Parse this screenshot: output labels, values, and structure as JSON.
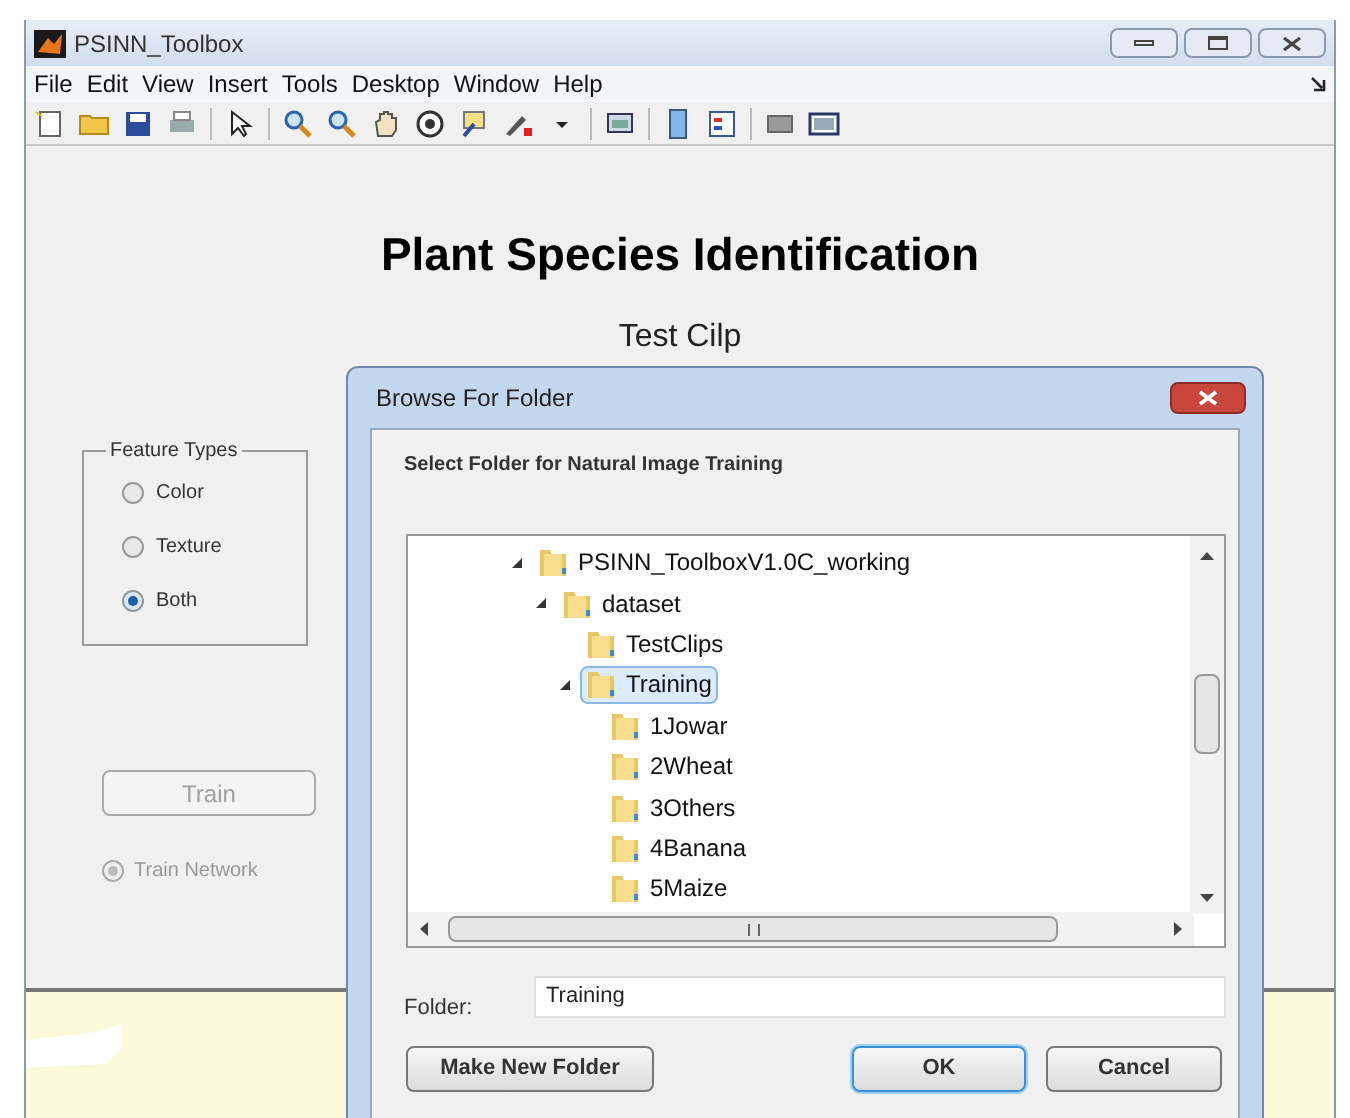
{
  "window": {
    "title": "PSINN_Toolbox"
  },
  "menu": [
    "File",
    "Edit",
    "View",
    "Insert",
    "Tools",
    "Desktop",
    "Window",
    "Help"
  ],
  "heading": "Plant Species Identification",
  "subtitle": "Test Cilp",
  "feature_types": {
    "title": "Feature Types",
    "options": [
      {
        "label": "Color",
        "selected": false
      },
      {
        "label": "Texture",
        "selected": false
      },
      {
        "label": "Both",
        "selected": true
      }
    ]
  },
  "train_button": {
    "label": "Train",
    "disabled": true
  },
  "train_network": {
    "label": "Train Network",
    "disabled": true
  },
  "dialog": {
    "title": "Browse For Folder",
    "instruction": "Select Folder for Natural Image Training",
    "tree": [
      {
        "label": "PSINN_ToolboxV1.0C_working",
        "expanded": true,
        "selected": false,
        "children": [
          {
            "label": "dataset",
            "expanded": true,
            "selected": false,
            "children": [
              {
                "label": "TestClips",
                "expanded": false,
                "selected": false
              },
              {
                "label": "Training",
                "expanded": true,
                "selected": true,
                "children": [
                  {
                    "label": "1Jowar",
                    "expanded": false,
                    "selected": false
                  },
                  {
                    "label": "2Wheat",
                    "expanded": false,
                    "selected": false
                  },
                  {
                    "label": "3Others",
                    "expanded": false,
                    "selected": false
                  },
                  {
                    "label": "4Banana",
                    "expanded": false,
                    "selected": false
                  },
                  {
                    "label": "5Maize",
                    "expanded": false,
                    "selected": false
                  }
                ]
              }
            ]
          }
        ]
      }
    ],
    "folder_label": "Folder:",
    "folder_value": "Training",
    "buttons": [
      {
        "label": "Make New Folder",
        "default": false
      },
      {
        "label": "OK",
        "default": true
      },
      {
        "label": "Cancel",
        "default": false
      }
    ]
  }
}
